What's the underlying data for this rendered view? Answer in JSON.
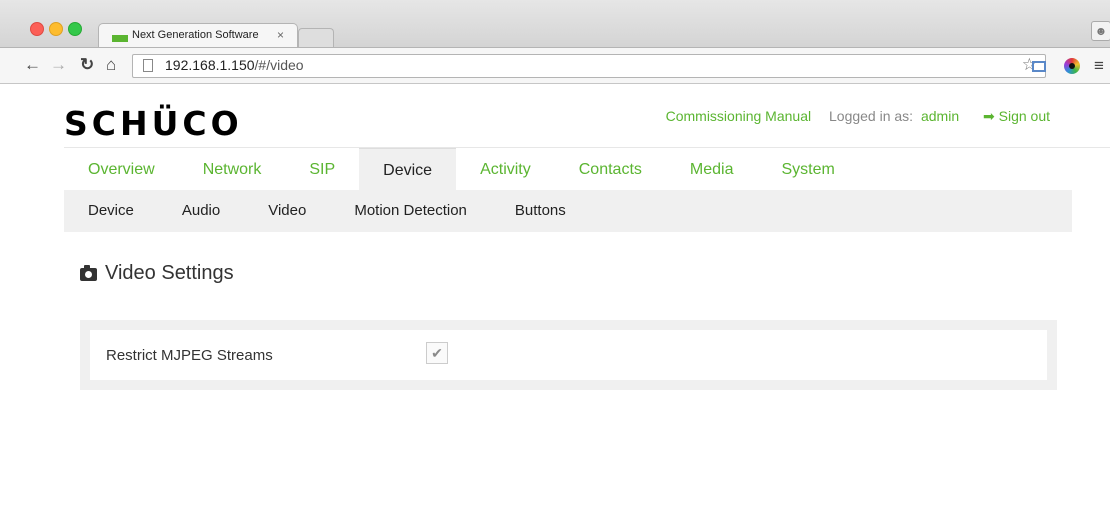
{
  "browser": {
    "tab_title": "Next Generation Software",
    "tab_close_glyph": "×",
    "url_host": "192.168.1.150",
    "url_path": "/#/video",
    "favicon_color": "#5bb531"
  },
  "header": {
    "logo": "SCHÜCO",
    "commissioning_manual": "Commissioning Manual",
    "logged_in_as_label": "Logged in as:",
    "username": "admin",
    "sign_out": "Sign out"
  },
  "main_nav": {
    "items": [
      "Overview",
      "Network",
      "SIP",
      "Device",
      "Activity",
      "Contacts",
      "Media",
      "System"
    ],
    "active": "Device"
  },
  "sub_nav": {
    "items": [
      "Device",
      "Audio",
      "Video",
      "Motion Detection",
      "Buttons"
    ]
  },
  "content": {
    "section_title": "Video Settings",
    "fields": [
      {
        "label": "Restrict MJPEG Streams",
        "checked": true
      }
    ]
  },
  "colors": {
    "accent": "#5bb531",
    "nav_active_bg": "#f0f0f0",
    "text": "#333333"
  },
  "icons": {
    "checkmark": "✔",
    "sign_out": "➡",
    "star": "☆",
    "menu": "≡"
  }
}
